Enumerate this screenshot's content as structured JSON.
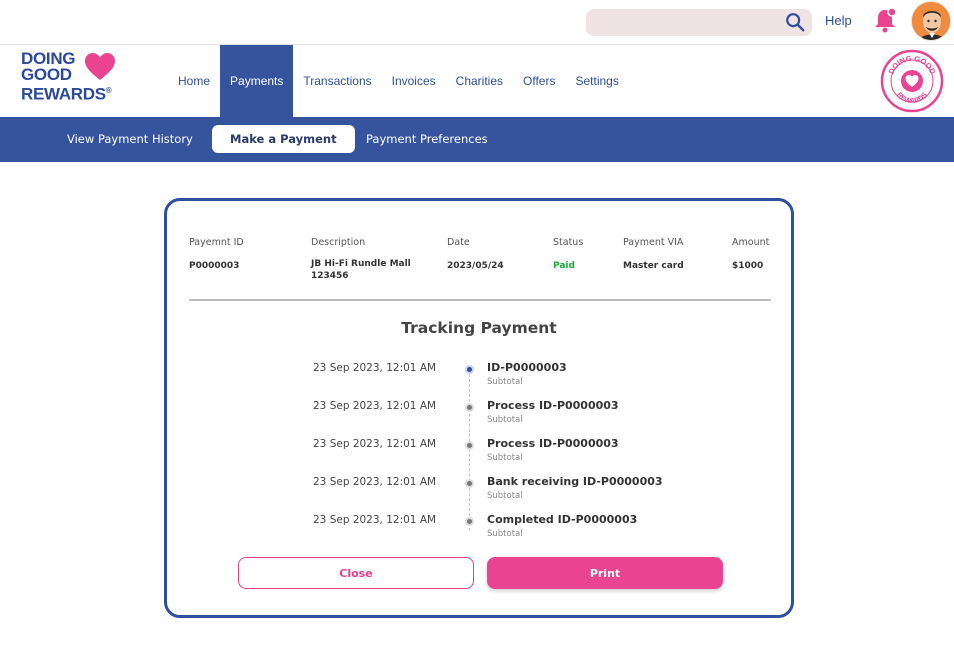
{
  "header": {
    "search": {
      "placeholder": "",
      "icon": "search-icon"
    },
    "help_label": "Help",
    "notification_icon": "bell-icon",
    "avatar": "user-avatar"
  },
  "brand": {
    "logo_lines": [
      "DOING",
      "GOOD",
      "REWARDS"
    ],
    "registered": "®",
    "badge_top": "DOING GOOD",
    "badge_bottom": "REWARDS",
    "colors": {
      "primary": "#36549e",
      "accent": "#ea4490"
    }
  },
  "nav": {
    "items": [
      {
        "label": "Home",
        "active": false
      },
      {
        "label": "Payments",
        "active": true
      },
      {
        "label": "Transactions",
        "active": false
      },
      {
        "label": "Invoices",
        "active": false
      },
      {
        "label": "Charities",
        "active": false
      },
      {
        "label": "Offers",
        "active": false
      },
      {
        "label": "Settings",
        "active": false
      }
    ]
  },
  "subnav": {
    "items": [
      {
        "label": "View Payment History",
        "active": false
      },
      {
        "label": "Make a Payment",
        "active": true
      },
      {
        "label": "Payment Preferences",
        "active": false
      }
    ]
  },
  "payment": {
    "headers": [
      "Payemnt ID",
      "Description",
      "Date",
      "Status",
      "Payment VIA",
      "Amount"
    ],
    "row": {
      "id": "P0000003",
      "description_line1": "JB Hi-Fi Rundle Mall",
      "description_line2": "123456",
      "date": "2023/05/24",
      "status": "Paid",
      "via": "Master card",
      "amount": "$1000"
    }
  },
  "tracking": {
    "title": "Tracking Payment",
    "steps": [
      {
        "date": "23 Sep 2023, 12:01 AM",
        "title": "ID-P0000003",
        "sub": "Subtotal"
      },
      {
        "date": "23 Sep 2023, 12:01 AM",
        "title": "Process ID-P0000003",
        "sub": "Subtotal"
      },
      {
        "date": "23 Sep 2023, 12:01 AM",
        "title": "Process ID-P0000003",
        "sub": "Subtotal"
      },
      {
        "date": "23 Sep 2023, 12:01 AM",
        "title": "Bank receiving ID-P0000003",
        "sub": "Subtotal"
      },
      {
        "date": "23 Sep 2023, 12:01 AM",
        "title": "Completed ID-P0000003",
        "sub": "Subtotal"
      }
    ]
  },
  "actions": {
    "close_label": "Close",
    "print_label": "Print"
  }
}
